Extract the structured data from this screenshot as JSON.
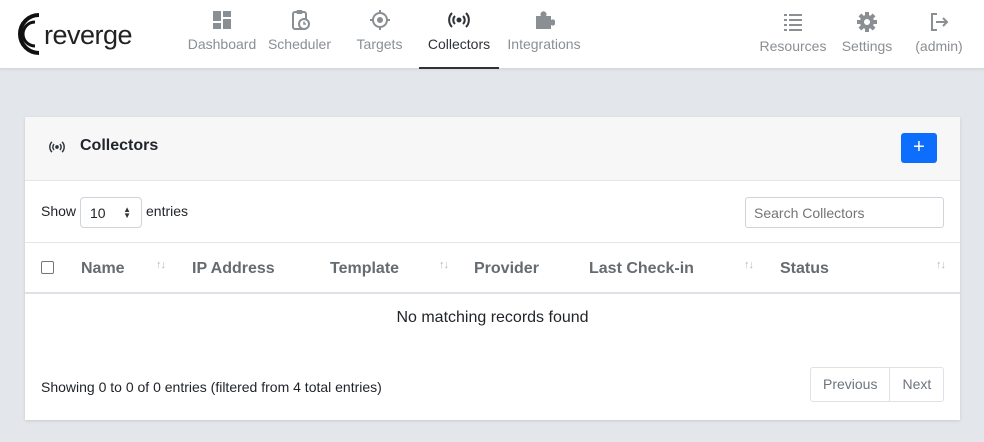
{
  "brand": {
    "name": "reverge"
  },
  "nav": {
    "main": [
      {
        "key": "dashboard",
        "label": "Dashboard",
        "icon": "dashboard-icon"
      },
      {
        "key": "scheduler",
        "label": "Scheduler",
        "icon": "clipboard-clock-icon"
      },
      {
        "key": "targets",
        "label": "Targets",
        "icon": "crosshairs-icon"
      },
      {
        "key": "collectors",
        "label": "Collectors",
        "icon": "broadcast-icon",
        "active": true
      },
      {
        "key": "integrations",
        "label": "Integrations",
        "icon": "puzzle-icon"
      }
    ],
    "right": [
      {
        "key": "resources",
        "label": "Resources",
        "icon": "list-icon"
      },
      {
        "key": "settings",
        "label": "Settings",
        "icon": "gear-icon"
      },
      {
        "key": "logout",
        "label": "(admin)",
        "icon": "logout-icon"
      }
    ]
  },
  "card": {
    "title": "Collectors",
    "icon": "broadcast-icon",
    "add_label": "+"
  },
  "table_controls": {
    "show_label": "Show",
    "page_size": "10",
    "entries_label": "entries",
    "search_placeholder": "Search Collectors"
  },
  "table": {
    "columns": [
      "Name",
      "IP Address",
      "Template",
      "Provider",
      "Last Check-in",
      "Status"
    ],
    "empty_text": "No matching records found",
    "info": "Showing 0 to 0 of 0 entries (filtered from 4 total entries)"
  },
  "pagination": {
    "previous": "Previous",
    "next": "Next"
  },
  "colors": {
    "accent": "#0d6efd",
    "nav_text": "#8a8f94",
    "active_text": "#2f3337"
  }
}
